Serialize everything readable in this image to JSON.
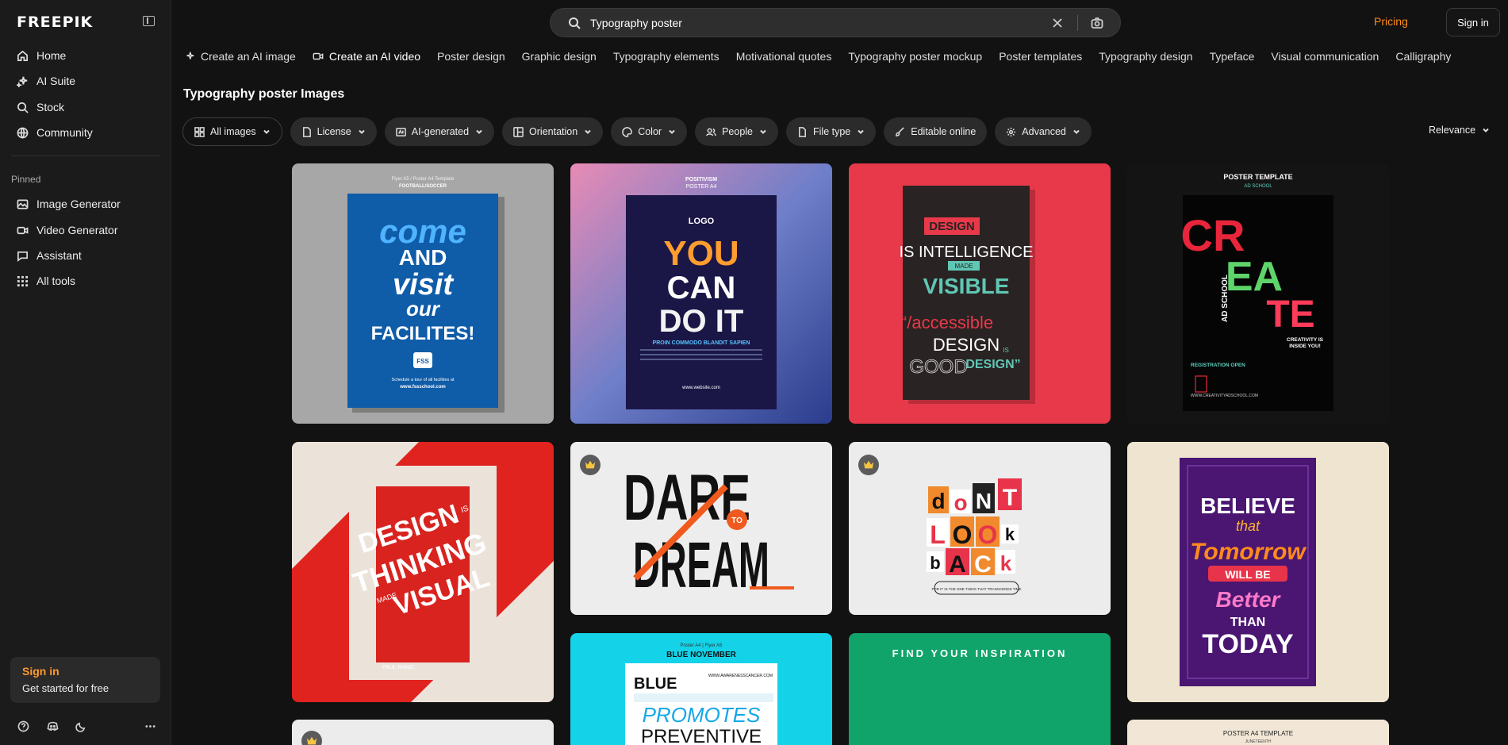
{
  "brand": {
    "logo": "FREEPIK"
  },
  "sidebar": {
    "nav": [
      {
        "label": "Home",
        "icon": "home-icon"
      },
      {
        "label": "AI Suite",
        "icon": "sparkle-icon"
      },
      {
        "label": "Stock",
        "icon": "search-icon"
      },
      {
        "label": "Community",
        "icon": "globe-icon"
      }
    ],
    "pinned_title": "Pinned",
    "pinned": [
      {
        "label": "Image Generator",
        "icon": "image-icon"
      },
      {
        "label": "Video Generator",
        "icon": "video-icon"
      },
      {
        "label": "Assistant",
        "icon": "chat-icon"
      },
      {
        "label": "All tools",
        "icon": "grid-icon"
      }
    ],
    "signin_card": {
      "title": "Sign in",
      "subtitle": "Get started for free"
    }
  },
  "search": {
    "value": "Typography poster"
  },
  "header": {
    "pricing": "Pricing",
    "signin": "Sign in"
  },
  "tags": [
    "Create an AI image",
    "Create an AI video",
    "Poster design",
    "Graphic design",
    "Typography elements",
    "Motivational quotes",
    "Typography poster mockup",
    "Poster templates",
    "Typography design",
    "Typeface",
    "Visual communication",
    "Calligraphy"
  ],
  "page_title": "Typography poster Images",
  "filters": [
    "All images",
    "License",
    "AI-generated",
    "Orientation",
    "Color",
    "People",
    "File type",
    "Editable online",
    "Advanced"
  ],
  "sort": "Relevance",
  "posters": {
    "p1": {
      "head1": "Flyer A5 / Poster A4 Template",
      "head2": "FOOTBALL/SOCCER",
      "l1": "come",
      "l2": "AND",
      "l3": "visit",
      "l4": "our",
      "l5": "FACILITES!",
      "badge": "FSS",
      "foot1": "Schedule a tour of all facilities at",
      "foot2": "www.fssschool.com"
    },
    "p2": {
      "head1": "POSITIVISM",
      "head2": "POSTER A4",
      "logo": "LOGO",
      "l1": "YOU",
      "l2": "CAN",
      "l3": "DO IT",
      "sub": "PROIN COMMODO BLANDIT SAPIEN",
      "site": "www.website.com"
    },
    "p3": {
      "l1": "DESIGN",
      "l2": "IS INTELLIGENCE",
      "l3": "MADE",
      "l4": "VISIBLE",
      "l5": "“/accessible",
      "l6": "DESIGN",
      "l7": "IS",
      "l8": "GOOD",
      "l9": "DESIGN”"
    },
    "p4": {
      "head1": "POSTER TEMPLATE",
      "head2": "AD SCHOOL",
      "l1": "CR",
      "l2": "EA",
      "l3": "TE",
      "side": "AD SCHOOL",
      "tag1": "CREATIVITY IS",
      "tag2": "INSIDE YOU!",
      "reg": "REGISTRATION OPEN",
      "site": "WWW.CREATIVITYADSCHOOL.COM"
    },
    "p5": {
      "l1": "DESIGN",
      "l2": "IS",
      "l3": "THINKING",
      "l4": "MADE",
      "l5": "VISUAL",
      "author": "PAUL RAND"
    },
    "p6": {
      "l1": "DARE",
      "l2": "TO",
      "l3": "DREAM"
    },
    "p7": {
      "l1": "d",
      "l2": "o",
      "l3": "N",
      "l4": "T",
      "l5": "L",
      "l6": "O",
      "l7": "O",
      "l8": "k",
      "l9": "b",
      "l10": "A",
      "l11": "C",
      "l12": "k",
      "foot": "FOR IT IS THE ONE THING THAT TRANSCENDS TIME"
    },
    "p8": {
      "l1": "BELIEVE",
      "l2": "that",
      "l3": "Tomorrow",
      "l4": "WILL BE",
      "l5": "Better",
      "l6": "THAN",
      "l7": "TODAY"
    },
    "p9": {
      "head1": "Poster A4 | Flyer A5",
      "head2": "BLUE NOVEMBER",
      "l1": "BLUE",
      "site": "WWW.AWARENESSCANCER.COM",
      "l2": "PROMOTES",
      "l3": "PREVENTIVE"
    },
    "p10": {
      "head": "FIND  YOUR  INSPIRATION"
    },
    "p12": {
      "head1": "POSTER A4 TEMPLATE",
      "head2": "JUNETEENTH"
    }
  }
}
